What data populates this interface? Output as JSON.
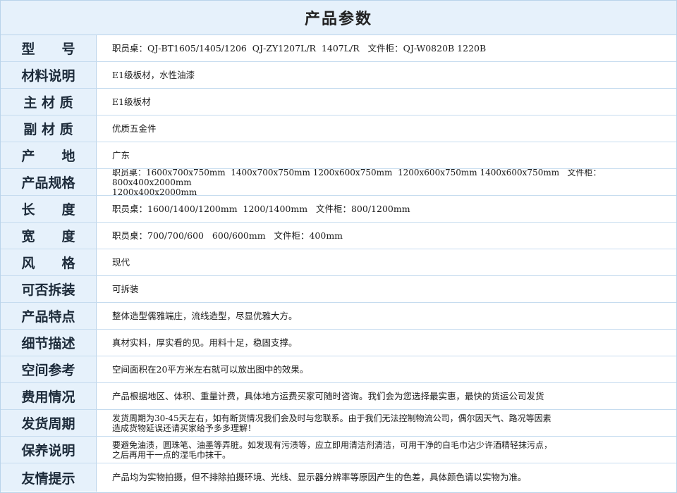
{
  "title": "产品参数",
  "rows": [
    {
      "label": "型　　号",
      "value": "职员桌：QJ-BT1605/1405/1206  QJ-ZY1207L/R  1407L/R   文件柜：QJ-W0820B 1220B"
    },
    {
      "label": "材料说明",
      "value": "E1级板材，水性油漆"
    },
    {
      "label": "主 材 质",
      "value": "E1级板材"
    },
    {
      "label": "副 材 质",
      "value": "优质五金件"
    },
    {
      "label": "产　　地",
      "value": "广东"
    },
    {
      "label": "产品规格",
      "value": "职员桌：1600x700x750mm  1400x700x750mm 1200x600x750mm  1200x600x750mm 1400x600x750mm   文件柜：800x400x2000mm\n1200x400x2000mm"
    },
    {
      "label": "长　　度",
      "value": "职员桌：1600/1400/1200mm  1200/1400mm   文件柜：800/1200mm"
    },
    {
      "label": "宽　　度",
      "value": "职员桌：700/700/600   600/600mm   文件柜：400mm"
    },
    {
      "label": "风　　格",
      "value": "现代"
    },
    {
      "label": "可否拆装",
      "value": "可拆装"
    },
    {
      "label": "产品特点",
      "value": "整体造型儒雅端庄，流线造型，尽显优雅大方。"
    },
    {
      "label": "细节描述",
      "value": "真材实料，厚实看的见。用料十足，稳固支撑。"
    },
    {
      "label": "空间参考",
      "value": "空间面积在20平方米左右就可以放出图中的效果。"
    },
    {
      "label": "费用情况",
      "value": "产品根据地区、体积、重量计费，具体地方运费买家可随时咨询。我们会为您选择最实惠，最快的货运公司发货"
    },
    {
      "label": "发货周期",
      "value": "发货周期为30-45天左右，如有断货情况我们会及时与您联系。由于我们无法控制物流公司，偶尔因天气、路况等因素\n造成货物延误还请买家给予多多理解！"
    },
    {
      "label": "保养说明",
      "value": "要避免油渍，圆珠笔、油墨等弄脏。如发现有污渍等，应立即用清洁剂清洁，可用干净的白毛巾沾少许酒精轻抹污点，\n之后再用干一点的湿毛巾抹干。"
    },
    {
      "label": "友情提示",
      "value": "产品均为实物拍摄，但不排除拍摄环境、光线、显示器分辨率等原因产生的色差，具体颜色请以实物为准。"
    }
  ]
}
